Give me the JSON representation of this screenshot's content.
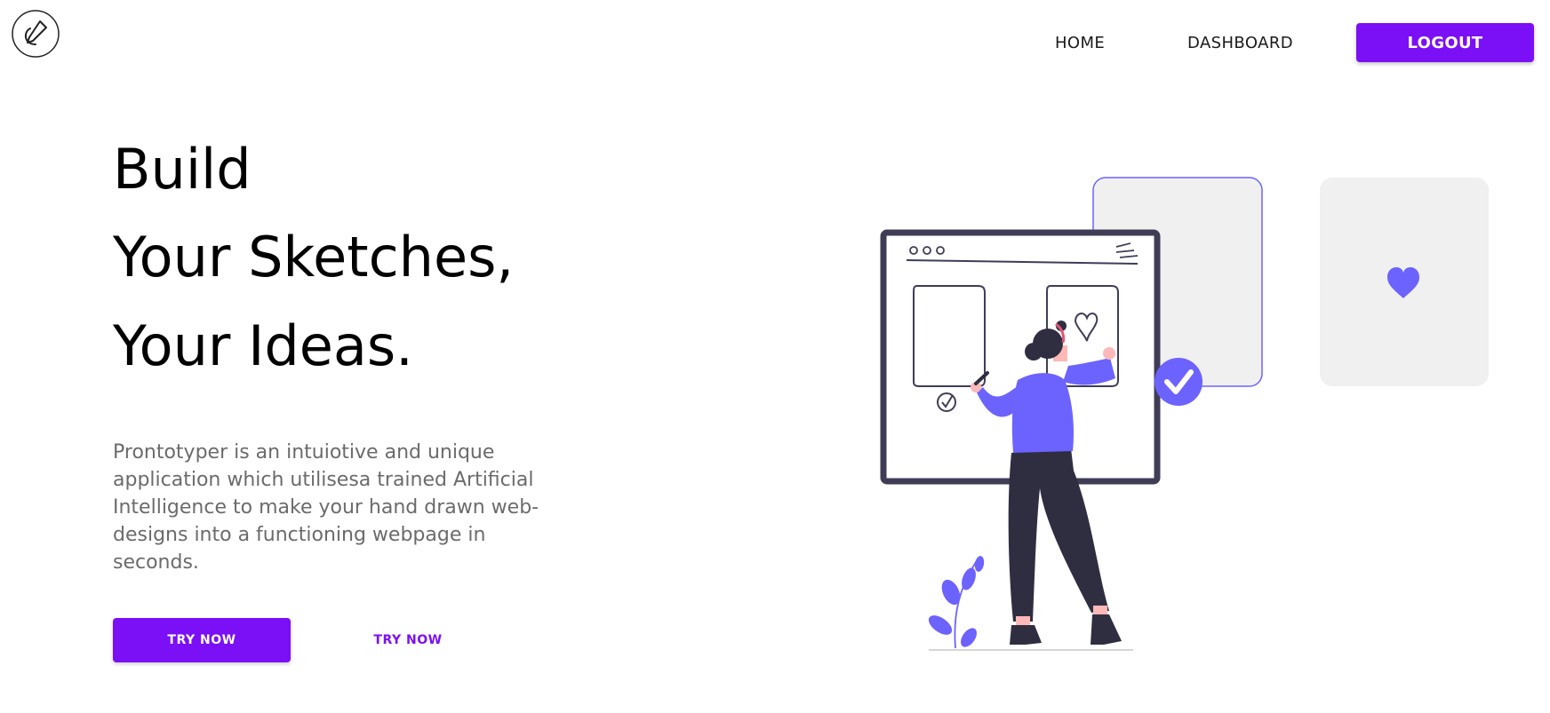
{
  "header": {
    "logo_icon": "pencil-circle-icon",
    "nav": {
      "home_label": "HOME",
      "dashboard_label": "DASHBOARD",
      "logout_label": "LOGOUT"
    }
  },
  "hero": {
    "title_lines": [
      "Build",
      "Your Sketches,",
      "Your Ideas."
    ],
    "description": "Prontotyper is an intuiotive and unique application which utilisesa trained Artificial Intelligence to make your hand drawn web-designs into a functioning webpage in seconds.",
    "primary_button_label": "TRY NOW",
    "secondary_button_label": "TRY NOW"
  },
  "illustration": {
    "icons": [
      "browser-window-icon",
      "check-circle-icon",
      "heart-icon",
      "plant-icon",
      "person-drawing-illustration"
    ]
  },
  "colors": {
    "accent": "#7b0ff5",
    "illustration_purple": "#6c63ff",
    "illustration_dark": "#2f2e41",
    "card_gray": "#f0f0f0",
    "description_text": "#6b6b6b"
  }
}
